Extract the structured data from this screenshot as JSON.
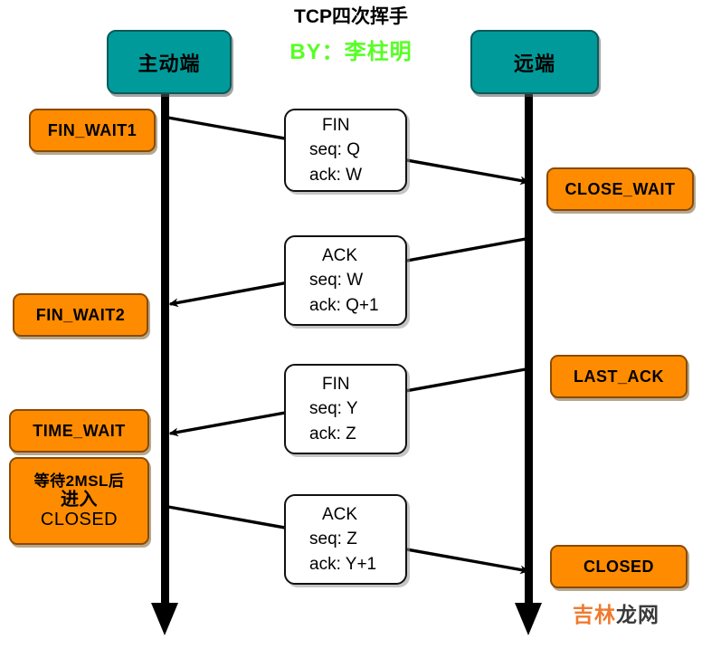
{
  "title": "TCP四次挥手",
  "byline": "BY：李柱明",
  "colors": {
    "endpoint_fill": "#019a9a",
    "state_fill": "#ff8c00",
    "byline_green": "#55ff22",
    "arrow_black": "#000000",
    "watermark_orange": "#ef7a30"
  },
  "endpoints": {
    "left": "主动端",
    "right": "远端"
  },
  "left_states": [
    {
      "label": "FIN_WAIT1"
    },
    {
      "label": "FIN_WAIT2"
    },
    {
      "label": "TIME_WAIT"
    },
    {
      "lines": [
        "等待2MSL后",
        "进入",
        "CLOSED"
      ]
    }
  ],
  "right_states": [
    {
      "label": "CLOSE_WAIT"
    },
    {
      "label": "LAST_ACK"
    },
    {
      "label": "CLOSED"
    }
  ],
  "messages": [
    {
      "flag": "FIN",
      "seq": "seq: Q",
      "ack": "ack: W",
      "direction": "left-to-right"
    },
    {
      "flag": "ACK",
      "seq": "seq: W",
      "ack": "ack: Q+1",
      "direction": "right-to-left"
    },
    {
      "flag": "FIN",
      "seq": "seq: Y",
      "ack": "ack: Z",
      "direction": "right-to-left"
    },
    {
      "flag": "ACK",
      "seq": "seq: Z",
      "ack": "ack: Y+1",
      "direction": "left-to-right"
    }
  ],
  "watermark": {
    "part1": "吉林",
    "part2": "龙网"
  }
}
